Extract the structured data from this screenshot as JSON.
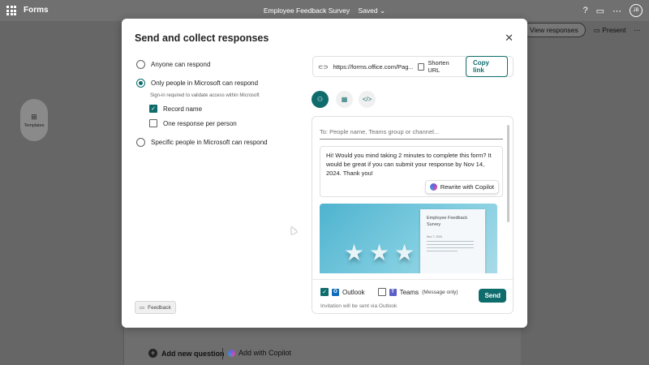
{
  "app": {
    "name": "Forms",
    "document_title": "Employee Feedback Survey",
    "saved_status": "Saved",
    "avatar_initials": "JB"
  },
  "background": {
    "templates_label": "Templates",
    "view_responses_label": "View responses",
    "present_label": "Present",
    "add_question_label": "Add new question",
    "add_copilot_label": "Add with Copilot"
  },
  "modal": {
    "title": "Send and collect responses",
    "options": {
      "anyone": "Anyone can respond",
      "org": "Only people in Microsoft can respond",
      "org_hint": "Sign-in required to validate access within Microsoft",
      "record_name": "Record name",
      "one_response": "One response per person",
      "specific": "Specific people in Microsoft can respond"
    },
    "selected_option": "org",
    "record_name_checked": true,
    "one_response_checked": false,
    "feedback_label": "Feedback",
    "link": {
      "url": "https://forms.office.com/Pag...",
      "shorten_label": "Shorten URL",
      "shorten_checked": false,
      "copy_label": "Copy link"
    },
    "send": {
      "to_placeholder": "To: People name, Teams group or channel...",
      "message": "Hi! Would you mind taking 2 minutes to complete this form? It would be great if you can submit your response by Nov 14, 2024. Thank you!",
      "rewrite_label": "Rewrite with Copilot",
      "preview_title": "Employee Feedback Survey",
      "preview_date": "Nov 7, 2024",
      "outlook_label": "Outlook",
      "outlook_checked": true,
      "teams_label": "Teams",
      "teams_note": "(Message only)",
      "teams_checked": false,
      "via_note": "Invitation will be sent via Outlook",
      "send_label": "Send"
    }
  },
  "colors": {
    "accent": "#0f6c6c",
    "overlay": "#6a6a6a"
  }
}
